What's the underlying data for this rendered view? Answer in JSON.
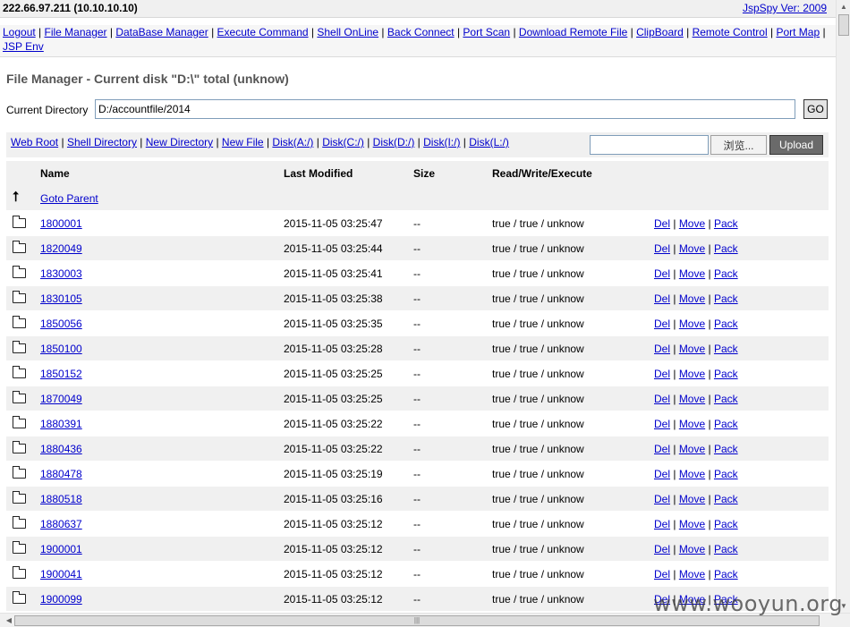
{
  "header": {
    "host": "222.66.97.211 (10.10.10.10)",
    "version_link": "JspSpy Ver: 2009"
  },
  "menu": [
    "Logout",
    "File Manager",
    "DataBase Manager",
    "Execute Command",
    "Shell OnLine",
    "Back Connect",
    "Port Scan",
    "Download Remote File",
    "ClipBoard",
    "Remote Control",
    "Port Map",
    "JSP Env"
  ],
  "page": {
    "title": "File Manager - Current disk \"D:\\\" total (unknow)",
    "dir_label": "Current Directory",
    "dir_value": "D:/accountfile/2014",
    "go_label": "GO"
  },
  "quick_links": [
    "Web Root",
    "Shell Directory",
    "New Directory",
    "New File",
    "Disk(A:/)",
    "Disk(C:/)",
    "Disk(D:/)",
    "Disk(I:/)",
    "Disk(L:/)"
  ],
  "upload": {
    "browse_label": "浏览...",
    "upload_label": "Upload"
  },
  "table": {
    "headers": [
      "Name",
      "Last Modified",
      "Size",
      "Read/Write/Execute"
    ],
    "parent_label": "Goto Parent",
    "icons": {
      "parent": "up-arrow-icon",
      "folder": "folder-icon"
    },
    "actions": [
      "Del",
      "Move",
      "Pack"
    ],
    "rows": [
      {
        "name": "1800001",
        "modified": "2015-11-05 03:25:47",
        "size": "--",
        "rwx": "true / true / unknow"
      },
      {
        "name": "1820049",
        "modified": "2015-11-05 03:25:44",
        "size": "--",
        "rwx": "true / true / unknow"
      },
      {
        "name": "1830003",
        "modified": "2015-11-05 03:25:41",
        "size": "--",
        "rwx": "true / true / unknow"
      },
      {
        "name": "1830105",
        "modified": "2015-11-05 03:25:38",
        "size": "--",
        "rwx": "true / true / unknow"
      },
      {
        "name": "1850056",
        "modified": "2015-11-05 03:25:35",
        "size": "--",
        "rwx": "true / true / unknow"
      },
      {
        "name": "1850100",
        "modified": "2015-11-05 03:25:28",
        "size": "--",
        "rwx": "true / true / unknow"
      },
      {
        "name": "1850152",
        "modified": "2015-11-05 03:25:25",
        "size": "--",
        "rwx": "true / true / unknow"
      },
      {
        "name": "1870049",
        "modified": "2015-11-05 03:25:25",
        "size": "--",
        "rwx": "true / true / unknow"
      },
      {
        "name": "1880391",
        "modified": "2015-11-05 03:25:22",
        "size": "--",
        "rwx": "true / true / unknow"
      },
      {
        "name": "1880436",
        "modified": "2015-11-05 03:25:22",
        "size": "--",
        "rwx": "true / true / unknow"
      },
      {
        "name": "1880478",
        "modified": "2015-11-05 03:25:19",
        "size": "--",
        "rwx": "true / true / unknow"
      },
      {
        "name": "1880518",
        "modified": "2015-11-05 03:25:16",
        "size": "--",
        "rwx": "true / true / unknow"
      },
      {
        "name": "1880637",
        "modified": "2015-11-05 03:25:12",
        "size": "--",
        "rwx": "true / true / unknow"
      },
      {
        "name": "1900001",
        "modified": "2015-11-05 03:25:12",
        "size": "--",
        "rwx": "true / true / unknow"
      },
      {
        "name": "1900041",
        "modified": "2015-11-05 03:25:12",
        "size": "--",
        "rwx": "true / true / unknow"
      },
      {
        "name": "1900099",
        "modified": "2015-11-05 03:25:12",
        "size": "--",
        "rwx": "true / true / unknow"
      }
    ]
  },
  "watermark": "www.wooyun.org"
}
